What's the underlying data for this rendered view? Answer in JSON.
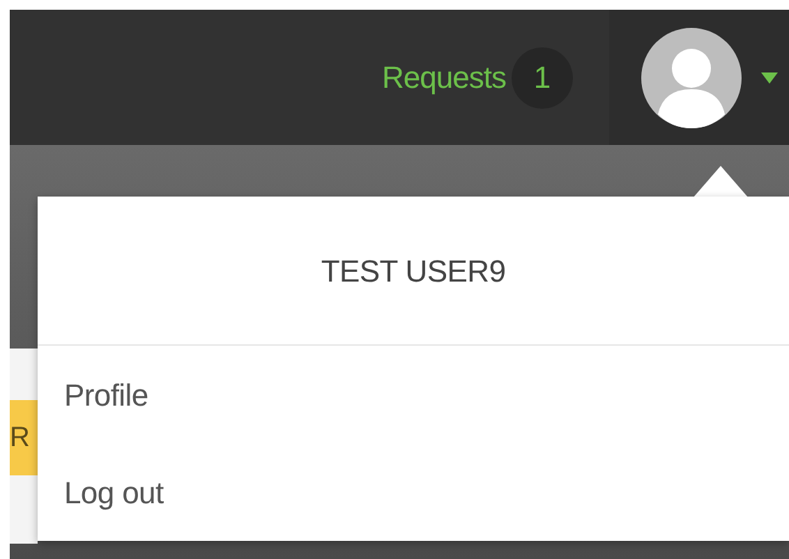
{
  "navbar": {
    "requests_link": "Requests",
    "requests_count": "1"
  },
  "sidebar": {
    "button_label": "R"
  },
  "user_menu": {
    "username": "TEST USER9",
    "items": [
      {
        "label": "Profile"
      },
      {
        "label": "Log out"
      }
    ]
  }
}
